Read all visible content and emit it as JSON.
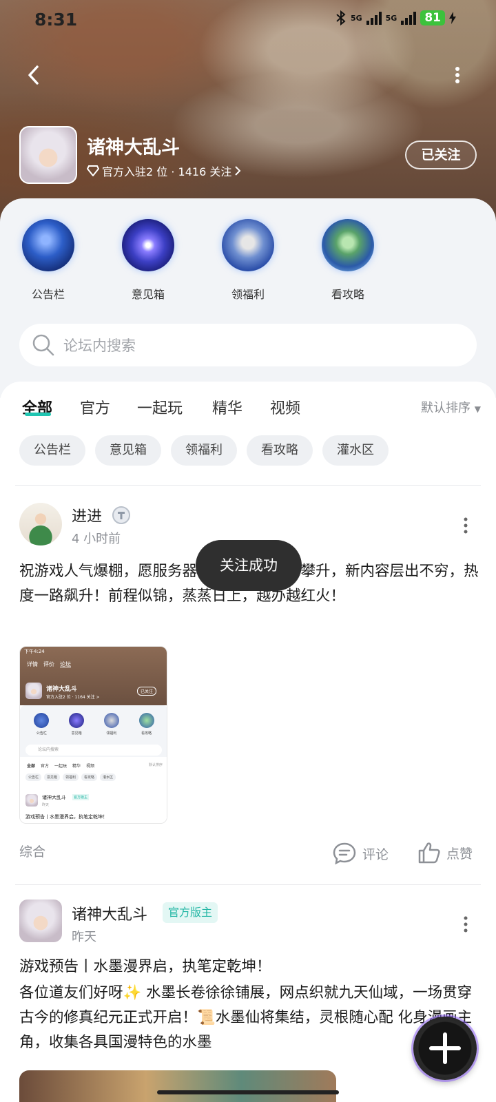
{
  "status_bar": {
    "time": "8:31",
    "net1": "5G",
    "net2": "5G",
    "battery": "81"
  },
  "forum": {
    "title": "诸神大乱斗",
    "meta": "官方入驻2 位 · 1416 关注",
    "follow_label": "已关注"
  },
  "quick_links": [
    {
      "label": "公告栏",
      "icon": "flag-banner-icon"
    },
    {
      "label": "意见箱",
      "icon": "galaxy-orb-icon"
    },
    {
      "label": "领福利",
      "icon": "scroll-quill-icon"
    },
    {
      "label": "看攻略",
      "icon": "jade-relic-icon"
    }
  ],
  "search": {
    "placeholder": "论坛内搜索"
  },
  "tabs": [
    "全部",
    "官方",
    "一起玩",
    "精华",
    "视频"
  ],
  "active_tab": "全部",
  "sort_label": "默认排序",
  "chips": [
    "公告栏",
    "意见箱",
    "领福利",
    "看攻略",
    "灌水区"
  ],
  "posts": [
    {
      "author": "进进",
      "time": "4 小时前",
      "text": "祝游戏人气爆棚，愿服务器常开，口碑节节攀升，新内容层出不穷，热度一路飙升！前程似锦，蒸蒸日上，越办越红火！",
      "category": "综合",
      "comment_label": "评论",
      "like_label": "点赞"
    },
    {
      "author": "诸神大乱斗",
      "badge": "官方版主",
      "time": "昨天",
      "title": "游戏预告丨水墨漫界启，执笔定乾坤！",
      "text": "各位道友们好呀✨ 水墨长卷徐徐铺展，网点织就九天仙域，一场贯穿古今的修真纪元正式开启！📜水墨仙将集结，灵根随心配 化身漫画主角，收集各具国漫特色的水墨"
    }
  ],
  "toast": "关注成功",
  "thumbnail": {
    "time": "下午4:24",
    "tabs": [
      "详情",
      "评价",
      "论坛"
    ],
    "title": "诸神大乱斗",
    "meta": "官方入驻2 位 · 1164 关注 >",
    "follow": "已关注",
    "links": [
      "公告栏",
      "意见箱",
      "领福利",
      "看攻略"
    ],
    "search": "论坛内搜索",
    "nav": [
      "全部",
      "官方",
      "一起玩",
      "精华",
      "视频"
    ],
    "sort": "默认排序",
    "chips": [
      "公告栏",
      "意见箱",
      "领福利",
      "看攻略",
      "灌水区"
    ],
    "post_author": "诸神大乱斗",
    "post_badge": "官方版主",
    "post_time": "昨天",
    "post_title": "游戏预告丨水墨漫界启，执笔定乾坤！"
  }
}
